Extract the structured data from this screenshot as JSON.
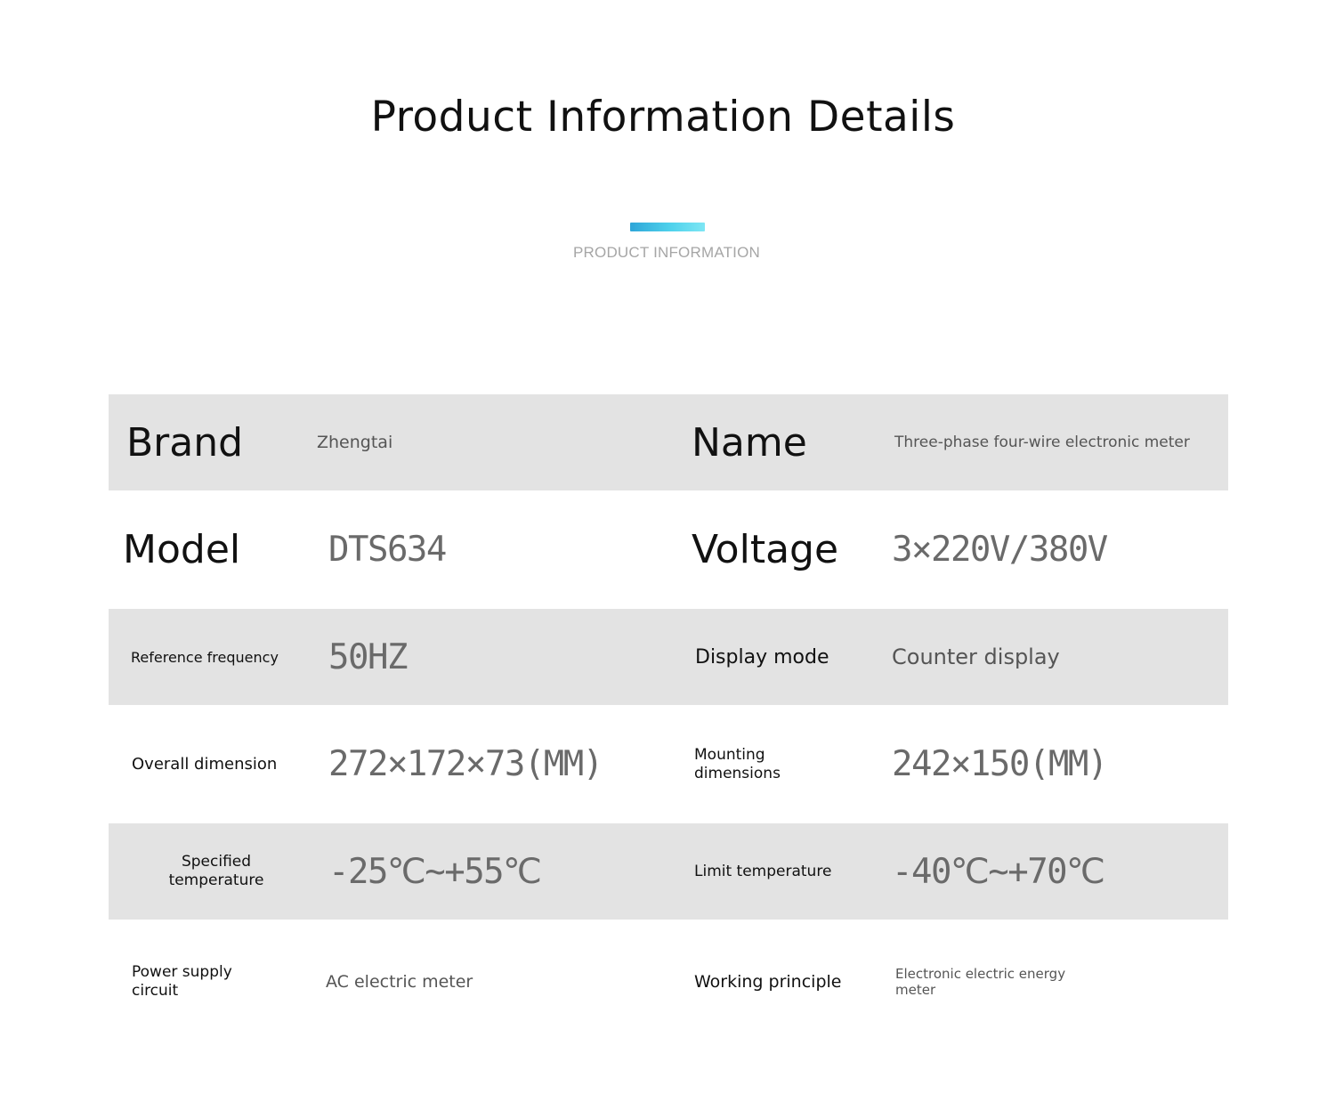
{
  "header": {
    "title": "Product Information Details",
    "subtitle": "PRODUCT INFORMATION",
    "accent_color": "#3bbde3"
  },
  "spec_rows": [
    {
      "label_1": "Brand",
      "value_1": "Zhengtai",
      "label_2": "Name",
      "value_2": "Three-phase four-wire electronic meter"
    },
    {
      "label_1": "Model",
      "value_1": "DTS634",
      "label_2": "Voltage",
      "value_2": "3×220V/380V"
    },
    {
      "label_1": "Reference frequency",
      "value_1": "50HZ",
      "label_2": "Display mode",
      "value_2": "Counter display"
    },
    {
      "label_1": "Overall dimension",
      "value_1": "272×172×73(MM)",
      "label_2": "Mounting dimensions",
      "value_2": "242×150(MM)"
    },
    {
      "label_1": "Specified temperature",
      "value_1": "-25℃~+55℃",
      "label_2": "Limit temperature",
      "value_2": "-40℃~+70℃"
    },
    {
      "label_1": "Power supply circuit",
      "value_1": "AC electric meter",
      "label_2": "Working principle",
      "value_2": "Electronic electric energy meter"
    }
  ]
}
